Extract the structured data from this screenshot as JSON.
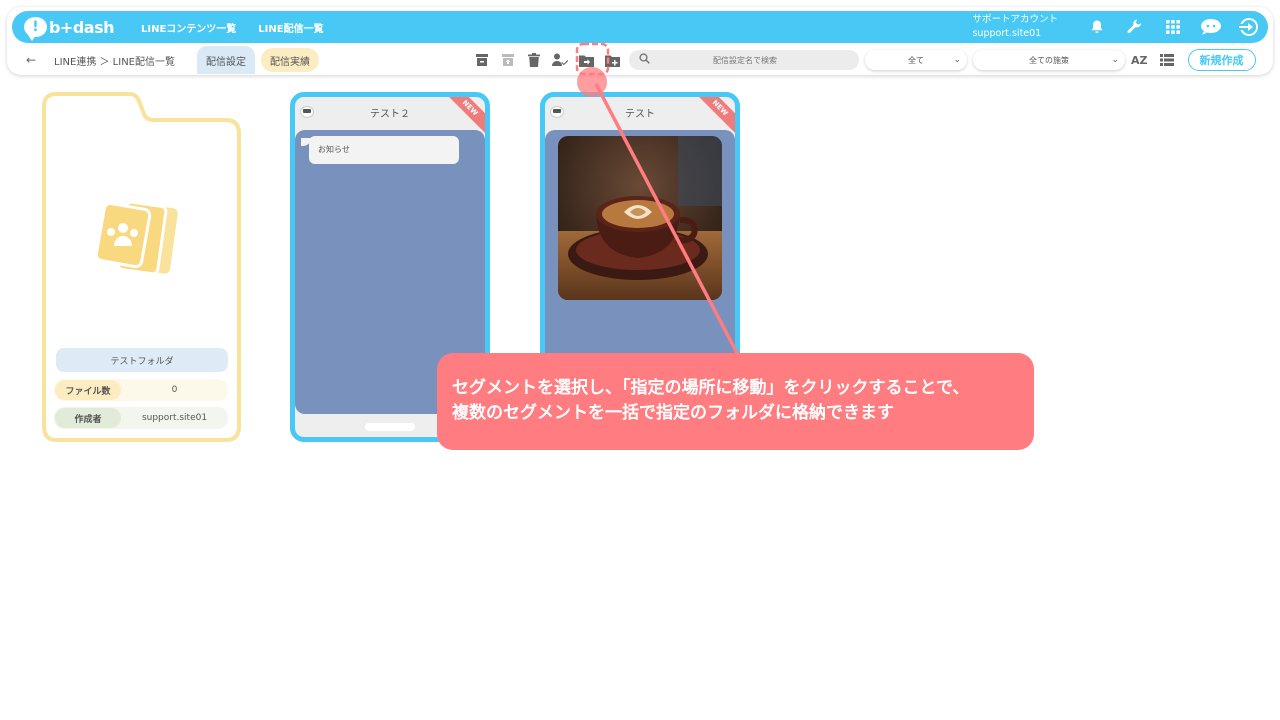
{
  "header": {
    "logo_mark": "!",
    "logo_text": "b+dash",
    "nav": [
      "LINEコンテンツ一覧",
      "LINE配信一覧"
    ],
    "account_label": "サポートアカウント",
    "account_id": "support.site01",
    "icons": [
      "bell-icon",
      "wrench-icon",
      "apps-grid-icon",
      "chat-icon",
      "logout-icon"
    ]
  },
  "subbar": {
    "back": "←",
    "breadcrumb": "LINE連携 ＞ LINE配信一覧",
    "tabs": [
      "配信設定",
      "配信実績"
    ],
    "search_placeholder": "配信設定名で検索",
    "filter_status": "全て",
    "filter_policy": "全ての施策",
    "sort_label": "AZ",
    "new_button": "新規作成"
  },
  "folder": {
    "name": "テストフォルダ",
    "files_label": "ファイル数",
    "files_value": "0",
    "author_label": "作成者",
    "author_value": "support.site01"
  },
  "cards": [
    {
      "title": "テスト２",
      "badge": "NEW",
      "message": "お知らせ"
    },
    {
      "title": "テスト",
      "badge": "NEW"
    }
  ],
  "annotation": {
    "line1": "セグメントを選択し、「指定の場所に移動」をクリックすることで、",
    "line2": "複数のセグメントを一括で指定のフォルダに格納できます"
  },
  "colors": {
    "accent": "#48c8f5",
    "callout": "#ff7c80",
    "folder": "#f9e29b",
    "screen": "#7892bd"
  }
}
